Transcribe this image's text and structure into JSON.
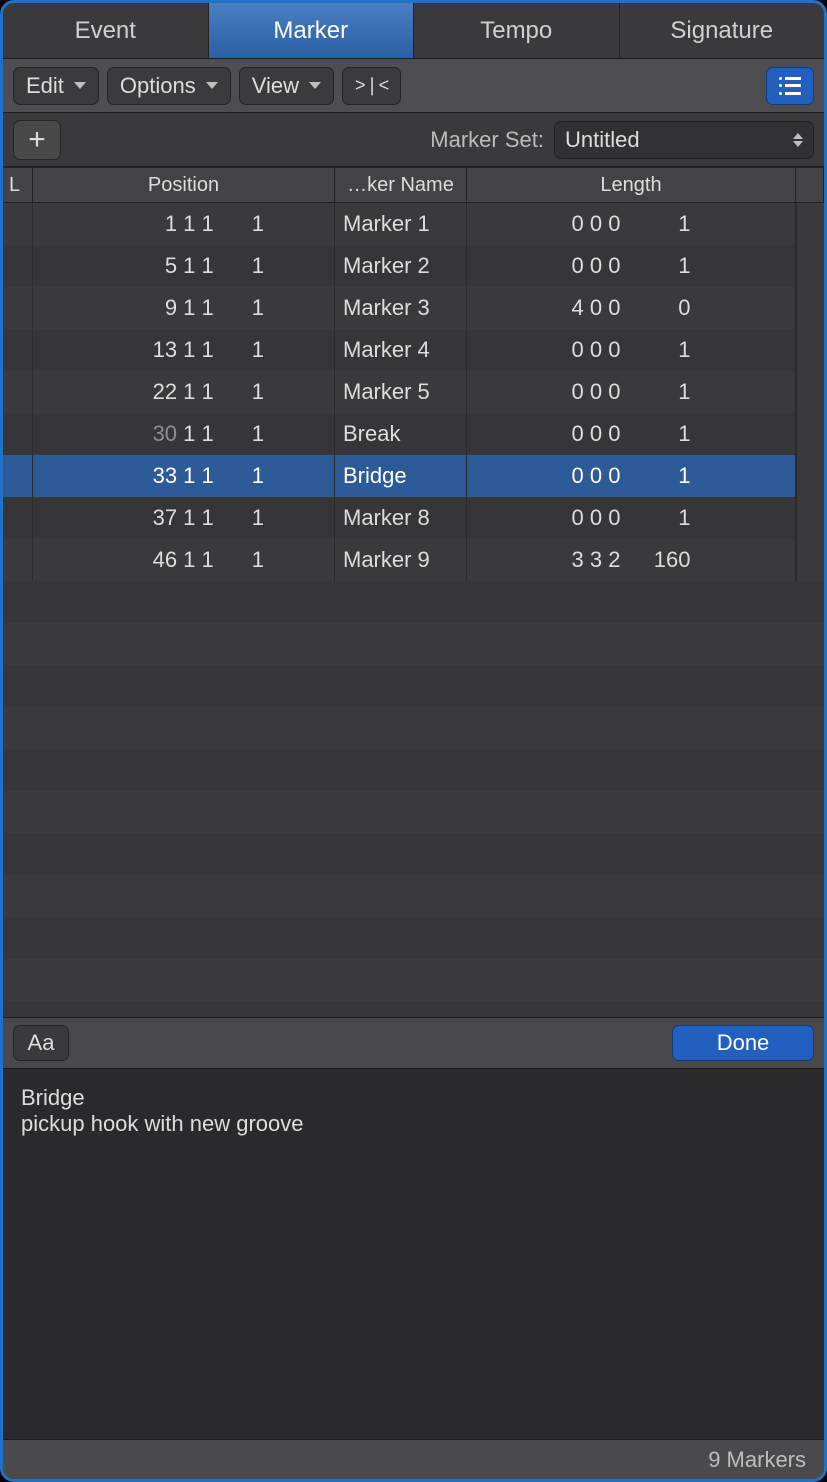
{
  "tabs": {
    "event": "Event",
    "marker": "Marker",
    "tempo": "Tempo",
    "signature": "Signature",
    "active": "marker"
  },
  "toolbar": {
    "edit": "Edit",
    "options": "Options",
    "view": "View",
    "catch_glyph": ">❘<"
  },
  "markerSet": {
    "label": "Marker Set:",
    "value": "Untitled"
  },
  "columns": {
    "l": "L",
    "position": "Position",
    "name": "…ker Name",
    "length": "Length"
  },
  "rows": [
    {
      "pos_bars": "1 1 1",
      "pos_tick": "1",
      "pos_dim": false,
      "name": "Marker 1",
      "len_triplet": "0 0 0",
      "len_tick": "1",
      "selected": false
    },
    {
      "pos_bars": "5 1 1",
      "pos_tick": "1",
      "pos_dim": false,
      "name": "Marker 2",
      "len_triplet": "0 0 0",
      "len_tick": "1",
      "selected": false
    },
    {
      "pos_bars": "9 1 1",
      "pos_tick": "1",
      "pos_dim": false,
      "name": "Marker 3",
      "len_triplet": "4 0 0",
      "len_tick": "0",
      "selected": false
    },
    {
      "pos_bars": "13 1 1",
      "pos_tick": "1",
      "pos_dim": false,
      "name": "Marker 4",
      "len_triplet": "0 0 0",
      "len_tick": "1",
      "selected": false
    },
    {
      "pos_bars": "22 1 1",
      "pos_tick": "1",
      "pos_dim": false,
      "name": "Marker 5",
      "len_triplet": "0 0 0",
      "len_tick": "1",
      "selected": false
    },
    {
      "pos_bars": "30 1 1",
      "pos_tick": "1",
      "pos_dim": true,
      "name": "Break",
      "len_triplet": "0 0 0",
      "len_tick": "1",
      "selected": false
    },
    {
      "pos_bars": "33 1 1",
      "pos_tick": "1",
      "pos_dim": false,
      "name": "Bridge",
      "len_triplet": "0 0 0",
      "len_tick": "1",
      "selected": true
    },
    {
      "pos_bars": "37 1 1",
      "pos_tick": "1",
      "pos_dim": false,
      "name": "Marker 8",
      "len_triplet": "0 0 0",
      "len_tick": "1",
      "selected": false
    },
    {
      "pos_bars": "46 1 1",
      "pos_tick": "1",
      "pos_dim": false,
      "name": "Marker 9",
      "len_triplet": "3 3 2",
      "len_tick": "160",
      "selected": false
    }
  ],
  "detail": {
    "aa": "Aa",
    "done": "Done",
    "title": "Bridge",
    "note": "pickup hook with new groove"
  },
  "footer": {
    "count": "9 Markers"
  }
}
